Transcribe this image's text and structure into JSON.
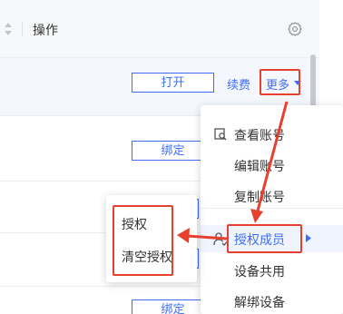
{
  "header": {
    "column_title": "操作"
  },
  "rows": [
    {
      "open_button": "打开",
      "renew_link": "续费",
      "more_link": "更多"
    },
    {
      "bind_button": "绑定"
    },
    {
      "bind_button": "绑定"
    }
  ],
  "dropdown": {
    "items": [
      {
        "label": "查看账号",
        "icon": "view-account-icon"
      },
      {
        "label": "编辑账号"
      },
      {
        "label": "复制账号"
      },
      {
        "label": "授权成员",
        "icon": "user-auth-icon",
        "has_submenu": true,
        "active": true
      },
      {
        "label": "设备共用"
      },
      {
        "label": "解绑设备"
      }
    ]
  },
  "submenu": {
    "items": [
      {
        "label": "授权"
      },
      {
        "label": "清空授权"
      }
    ]
  },
  "colors": {
    "accent": "#3f6ef5",
    "annotation": "#e8402f",
    "header_bg": "#f7f8fa",
    "selected_row_bg": "#f5f7ff"
  }
}
